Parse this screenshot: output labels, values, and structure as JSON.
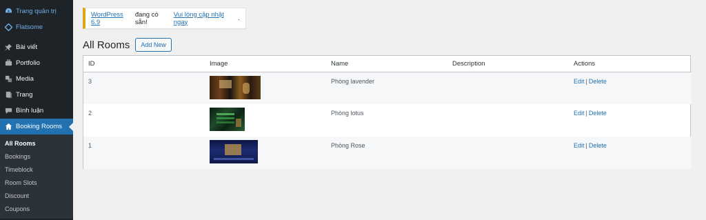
{
  "sidebar": {
    "top_items": [
      {
        "label": "Trang quản trị",
        "icon": "dashboard-icon"
      },
      {
        "label": "Flatsome",
        "icon": "flatsome-icon"
      }
    ],
    "items": [
      {
        "label": "Bài viết",
        "icon": "pin-icon"
      },
      {
        "label": "Portfolio",
        "icon": "portfolio-icon"
      },
      {
        "label": "Media",
        "icon": "media-icon"
      },
      {
        "label": "Trang",
        "icon": "page-icon"
      },
      {
        "label": "Bình luận",
        "icon": "comment-icon"
      },
      {
        "label": "Booking Rooms",
        "icon": "home-icon"
      }
    ],
    "submenu": [
      "All Rooms",
      "Bookings",
      "Timeblock",
      "Room Slots",
      "Discount",
      "Coupons"
    ]
  },
  "notice": {
    "link_version": "WordPress 6.9",
    "text": "đang có sẵn!",
    "link_update": "Vui lòng cập nhật ngay",
    "suffix": ".",
    "accent_color": "#dba617"
  },
  "page": {
    "title": "All Rooms",
    "add_new_label": "Add New"
  },
  "table": {
    "headers": [
      "ID",
      "Image",
      "Name",
      "Description",
      "Actions"
    ],
    "rows": [
      {
        "id": "3",
        "name": "Phòng lavender",
        "description": "",
        "edit": "Edit",
        "sep": "|",
        "delete": "Delete"
      },
      {
        "id": "2",
        "name": "Phòng lotus",
        "description": "",
        "edit": "Edit",
        "sep": "|",
        "delete": "Delete"
      },
      {
        "id": "1",
        "name": "Phòng Rose",
        "description": "",
        "edit": "Edit",
        "sep": "|",
        "delete": "Delete"
      }
    ]
  },
  "colors": {
    "sidebar_bg": "#1d2327",
    "active_bg": "#2271b1",
    "link": "#2271b1"
  }
}
